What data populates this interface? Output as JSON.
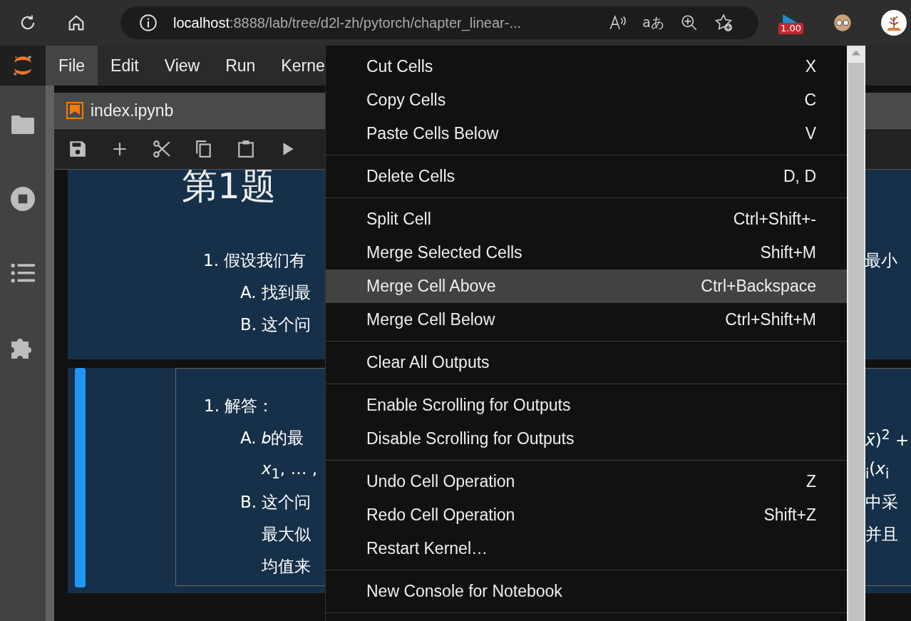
{
  "browser": {
    "url_host": "localhost",
    "url_rest": ":8888/lab/tree/d2l-zh/pytorch/chapter_linear-...",
    "translate_glyph": "aあ",
    "extension_badge": "1.00"
  },
  "menubar": [
    {
      "label": "File",
      "selected": true
    },
    {
      "label": "Edit",
      "selected": false
    },
    {
      "label": "View",
      "selected": false
    },
    {
      "label": "Run",
      "selected": false
    },
    {
      "label": "Kerne",
      "selected": false
    }
  ],
  "tab": {
    "label": "index.ipynb"
  },
  "notebook": {
    "heading": "第1题",
    "question": [
      {
        "kind": "item",
        "left": "1. 假设我们有",
        "right": "最小"
      },
      {
        "kind": "sub",
        "left": "A. 找到最"
      },
      {
        "kind": "sub",
        "left": "B. 这个问"
      }
    ],
    "answer_active": true,
    "answer": [
      {
        "kind": "item",
        "left": "1. 解答："
      },
      {
        "kind": "sub",
        "left": "A. 𝑏的最",
        "right": "*x̄*)$^{2}$ +"
      },
      {
        "kind": "cont",
        "left": "*x*$_{1}$, … ,",
        "right": "$_{i}$(*x*$_{i}$"
      },
      {
        "kind": "sub",
        "left": "B. 这个问",
        "right": "中采"
      },
      {
        "kind": "cont",
        "left": "最大似",
        "right": "并且"
      },
      {
        "kind": "cont",
        "left": "均值来"
      }
    ]
  },
  "menu": {
    "sections": [
      [
        {
          "label": "Cut Cells",
          "shortcut": "X",
          "selected": false
        },
        {
          "label": "Copy Cells",
          "shortcut": "C",
          "selected": false
        },
        {
          "label": "Paste Cells Below",
          "shortcut": "V",
          "selected": false
        }
      ],
      [
        {
          "label": "Delete Cells",
          "shortcut": "D, D",
          "selected": false
        }
      ],
      [
        {
          "label": "Split Cell",
          "shortcut": "Ctrl+Shift+-",
          "selected": false
        },
        {
          "label": "Merge Selected Cells",
          "shortcut": "Shift+M",
          "selected": false
        },
        {
          "label": "Merge Cell Above",
          "shortcut": "Ctrl+Backspace",
          "selected": true
        },
        {
          "label": "Merge Cell Below",
          "shortcut": "Ctrl+Shift+M",
          "selected": false
        }
      ],
      [
        {
          "label": "Clear All Outputs",
          "selected": false
        }
      ],
      [
        {
          "label": "Enable Scrolling for Outputs",
          "selected": false
        },
        {
          "label": "Disable Scrolling for Outputs",
          "selected": false
        }
      ],
      [
        {
          "label": "Undo Cell Operation",
          "shortcut": "Z",
          "selected": false
        },
        {
          "label": "Redo Cell Operation",
          "shortcut": "Shift+Z",
          "selected": false
        },
        {
          "label": "Restart Kernel…",
          "selected": false
        }
      ],
      [
        {
          "label": "New Console for Notebook",
          "selected": false
        }
      ]
    ]
  }
}
